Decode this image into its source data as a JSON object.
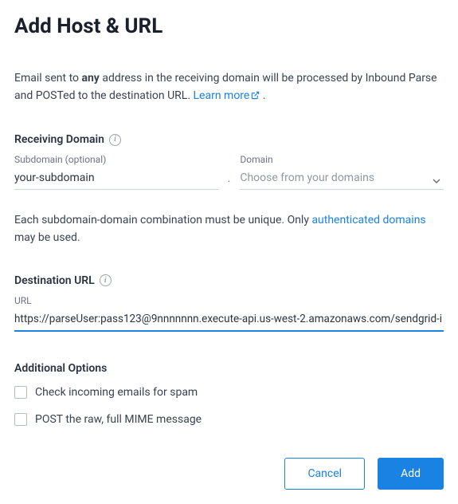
{
  "title": "Add Host & URL",
  "intro": {
    "prefix": "Email sent to ",
    "any": "any",
    "suffix": " address in the receiving domain will be processed by Inbound Parse and POSTed to the destination URL. ",
    "learn_more": "Learn more",
    "period": " ."
  },
  "receiving_domain": {
    "label": "Receiving Domain",
    "subdomain_label": "Subdomain (optional)",
    "subdomain_value": "your-subdomain",
    "domain_label": "Domain",
    "domain_placeholder": "Choose from your domains",
    "separator": "."
  },
  "domain_helper": {
    "prefix": "Each subdomain-domain combination must be unique. Only ",
    "link": "authenticated domains",
    "suffix": " may be used."
  },
  "destination": {
    "label": "Destination URL",
    "url_label": "URL",
    "url_value": "https://parseUser:pass123@9nnnnnnn.execute-api.us-west-2.amazonaws.com/sendgrid-i"
  },
  "additional": {
    "label": "Additional Options",
    "spam_label": "Check incoming emails for spam",
    "raw_label": "POST the raw, full MIME message"
  },
  "footer": {
    "cancel": "Cancel",
    "add": "Add"
  },
  "colors": {
    "link": "#1a82e2",
    "primary": "#1a82e2"
  }
}
